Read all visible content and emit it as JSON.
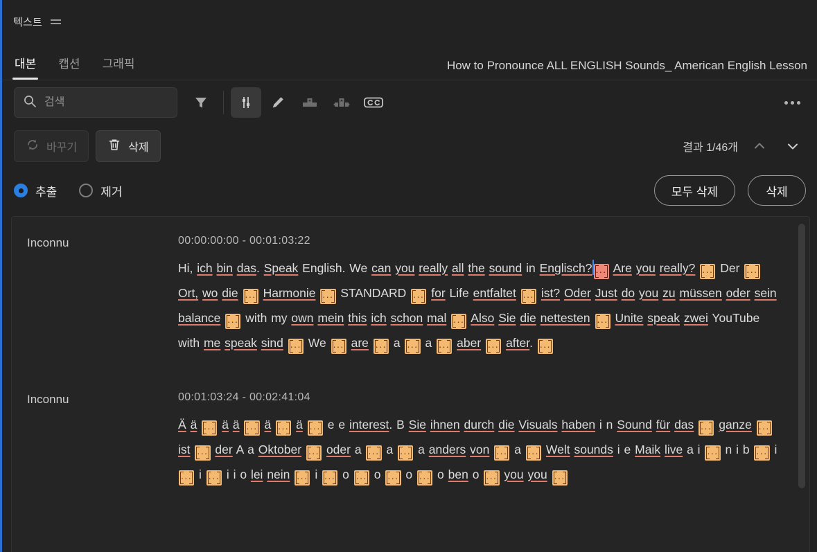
{
  "panel": {
    "title": "텍스트",
    "menu_icon": "hamburger-icon"
  },
  "tabs": [
    {
      "label": "대본",
      "active": true
    },
    {
      "label": "캡션",
      "active": false
    },
    {
      "label": "그래픽",
      "active": false
    }
  ],
  "sequence_title": "How to Pronounce ALL ENGLISH Sounds_ American English Lesson",
  "search": {
    "placeholder": "검색",
    "value": "",
    "icon": "search-icon"
  },
  "toolbar_icons": [
    {
      "name": "filter-icon",
      "selected": false
    },
    {
      "name": "pause-markers-icon",
      "selected": true
    },
    {
      "name": "edit-pencil-icon",
      "selected": false
    },
    {
      "name": "merge-clips-icon",
      "selected": false
    },
    {
      "name": "split-clips-icon",
      "selected": false
    },
    {
      "name": "closed-caption-icon",
      "selected": false
    }
  ],
  "more_menu": {
    "name": "more-options-icon",
    "label": "..."
  },
  "actions": {
    "replace_label": "바꾸기",
    "replace_icon": "refresh-icon",
    "replace_disabled": true,
    "delete_label": "삭제",
    "delete_icon": "trash-icon"
  },
  "results": {
    "text": "결과 1/46개",
    "prev_icon": "chevron-up-icon",
    "next_icon": "chevron-down-icon"
  },
  "mode": {
    "options": [
      {
        "label": "추출",
        "checked": true
      },
      {
        "label": "제거",
        "checked": false
      }
    ],
    "delete_all_label": "모두 삭제",
    "delete_label": "삭제"
  },
  "colors": {
    "accent_blue": "#2a7fe0",
    "token_orange": "#f4ba72",
    "token_highlight": "#f08878",
    "spellcheck_underline": "#e07a6a",
    "panel_bg": "#222222",
    "transcript_bg": "#252525"
  },
  "transcript": {
    "token_text": "...",
    "blocks": [
      {
        "speaker": "Inconnu",
        "timecode": "00:00:00:00 - 00:01:03:22",
        "segments": [
          {
            "t": "text",
            "v": "Hi, "
          },
          {
            "t": "uword",
            "v": "ich"
          },
          {
            "t": "text",
            "v": " "
          },
          {
            "t": "uword",
            "v": "bin"
          },
          {
            "t": "text",
            "v": " "
          },
          {
            "t": "uword",
            "v": "das"
          },
          {
            "t": "text",
            "v": ". "
          },
          {
            "t": "uword",
            "v": "Speak"
          },
          {
            "t": "text",
            "v": " English. We "
          },
          {
            "t": "uword",
            "v": "can"
          },
          {
            "t": "text",
            "v": " "
          },
          {
            "t": "uword",
            "v": "you"
          },
          {
            "t": "text",
            "v": " "
          },
          {
            "t": "uword",
            "v": "really"
          },
          {
            "t": "text",
            "v": " "
          },
          {
            "t": "uword",
            "v": "all"
          },
          {
            "t": "text",
            "v": " "
          },
          {
            "t": "uword",
            "v": "the"
          },
          {
            "t": "text",
            "v": " "
          },
          {
            "t": "uword",
            "v": "sound"
          },
          {
            "t": "text",
            "v": " in "
          },
          {
            "t": "uword",
            "v": "Englisch?"
          },
          {
            "t": "caret"
          },
          {
            "t": "token",
            "hit": true
          },
          {
            "t": "text",
            "v": " "
          },
          {
            "t": "uword",
            "v": "Are"
          },
          {
            "t": "text",
            "v": " "
          },
          {
            "t": "uword",
            "v": "you"
          },
          {
            "t": "text",
            "v": " "
          },
          {
            "t": "uword",
            "v": "really?"
          },
          {
            "t": "text",
            "v": " "
          },
          {
            "t": "token"
          },
          {
            "t": "text",
            "v": " Der "
          },
          {
            "t": "token"
          },
          {
            "t": "text",
            "v": " "
          },
          {
            "t": "uword",
            "v": "Ort,"
          },
          {
            "t": "text",
            "v": " "
          },
          {
            "t": "uword",
            "v": "wo"
          },
          {
            "t": "text",
            "v": " "
          },
          {
            "t": "uword",
            "v": "die"
          },
          {
            "t": "text",
            "v": " "
          },
          {
            "t": "token"
          },
          {
            "t": "text",
            "v": " "
          },
          {
            "t": "uword",
            "v": "Harmonie"
          },
          {
            "t": "text",
            "v": " "
          },
          {
            "t": "token"
          },
          {
            "t": "text",
            "v": " STANDARD "
          },
          {
            "t": "token"
          },
          {
            "t": "text",
            "v": " "
          },
          {
            "t": "uword",
            "v": "for"
          },
          {
            "t": "text",
            "v": " Life "
          },
          {
            "t": "uword",
            "v": "entfaltet"
          },
          {
            "t": "text",
            "v": " "
          },
          {
            "t": "token"
          },
          {
            "t": "text",
            "v": " "
          },
          {
            "t": "uword",
            "v": "ist?"
          },
          {
            "t": "text",
            "v": " "
          },
          {
            "t": "uword",
            "v": "Oder"
          },
          {
            "t": "text",
            "v": " "
          },
          {
            "t": "uword",
            "v": "Just"
          },
          {
            "t": "text",
            "v": " "
          },
          {
            "t": "uword",
            "v": "do"
          },
          {
            "t": "text",
            "v": " "
          },
          {
            "t": "uword",
            "v": "you"
          },
          {
            "t": "text",
            "v": " "
          },
          {
            "t": "uword",
            "v": "zu"
          },
          {
            "t": "text",
            "v": " "
          },
          {
            "t": "uword",
            "v": "müssen"
          },
          {
            "t": "text",
            "v": " "
          },
          {
            "t": "uword",
            "v": "oder"
          },
          {
            "t": "text",
            "v": " "
          },
          {
            "t": "uword",
            "v": "sein"
          },
          {
            "t": "text",
            "v": " "
          },
          {
            "t": "uword",
            "v": "balance"
          },
          {
            "t": "text",
            "v": " "
          },
          {
            "t": "token"
          },
          {
            "t": "text",
            "v": " with my "
          },
          {
            "t": "uword",
            "v": "own"
          },
          {
            "t": "text",
            "v": " "
          },
          {
            "t": "uword",
            "v": "mein"
          },
          {
            "t": "text",
            "v": " "
          },
          {
            "t": "uword",
            "v": "this"
          },
          {
            "t": "text",
            "v": " "
          },
          {
            "t": "uword",
            "v": "ich"
          },
          {
            "t": "text",
            "v": " "
          },
          {
            "t": "uword",
            "v": "schon"
          },
          {
            "t": "text",
            "v": " "
          },
          {
            "t": "uword",
            "v": "mal"
          },
          {
            "t": "text",
            "v": " "
          },
          {
            "t": "token"
          },
          {
            "t": "text",
            "v": " "
          },
          {
            "t": "uword",
            "v": "Also"
          },
          {
            "t": "text",
            "v": " "
          },
          {
            "t": "uword",
            "v": "Sie"
          },
          {
            "t": "text",
            "v": " "
          },
          {
            "t": "uword",
            "v": "die"
          },
          {
            "t": "text",
            "v": " "
          },
          {
            "t": "uword",
            "v": "nettesten"
          },
          {
            "t": "text",
            "v": " "
          },
          {
            "t": "token"
          },
          {
            "t": "text",
            "v": " "
          },
          {
            "t": "uword",
            "v": "Unite"
          },
          {
            "t": "text",
            "v": " "
          },
          {
            "t": "uword",
            "v": "speak"
          },
          {
            "t": "text",
            "v": " "
          },
          {
            "t": "uword",
            "v": "zwei"
          },
          {
            "t": "text",
            "v": " YouTube with "
          },
          {
            "t": "uword",
            "v": "me"
          },
          {
            "t": "text",
            "v": " "
          },
          {
            "t": "uword",
            "v": "speak"
          },
          {
            "t": "text",
            "v": " "
          },
          {
            "t": "uword",
            "v": "sind"
          },
          {
            "t": "text",
            "v": " "
          },
          {
            "t": "token"
          },
          {
            "t": "text",
            "v": " We "
          },
          {
            "t": "token"
          },
          {
            "t": "text",
            "v": " "
          },
          {
            "t": "uword",
            "v": "are"
          },
          {
            "t": "text",
            "v": " "
          },
          {
            "t": "token"
          },
          {
            "t": "text",
            "v": " a "
          },
          {
            "t": "token"
          },
          {
            "t": "text",
            "v": " a "
          },
          {
            "t": "token"
          },
          {
            "t": "text",
            "v": " "
          },
          {
            "t": "uword",
            "v": "aber"
          },
          {
            "t": "text",
            "v": " "
          },
          {
            "t": "token"
          },
          {
            "t": "text",
            "v": " "
          },
          {
            "t": "uword",
            "v": "after"
          },
          {
            "t": "text",
            "v": ". "
          },
          {
            "t": "token"
          }
        ]
      },
      {
        "speaker": "Inconnu",
        "timecode": "00:01:03:24 - 00:02:41:04",
        "segments": [
          {
            "t": "uword",
            "v": "Ä"
          },
          {
            "t": "text",
            "v": " "
          },
          {
            "t": "uword",
            "v": "ä"
          },
          {
            "t": "text",
            "v": " "
          },
          {
            "t": "token"
          },
          {
            "t": "text",
            "v": " "
          },
          {
            "t": "uword",
            "v": "ä"
          },
          {
            "t": "text",
            "v": " "
          },
          {
            "t": "uword",
            "v": "ä"
          },
          {
            "t": "text",
            "v": " "
          },
          {
            "t": "token"
          },
          {
            "t": "text",
            "v": " "
          },
          {
            "t": "uword",
            "v": "ä"
          },
          {
            "t": "text",
            "v": " "
          },
          {
            "t": "token"
          },
          {
            "t": "text",
            "v": " "
          },
          {
            "t": "uword",
            "v": "ä"
          },
          {
            "t": "text",
            "v": " "
          },
          {
            "t": "token"
          },
          {
            "t": "text",
            "v": " e e "
          },
          {
            "t": "uword",
            "v": "interest"
          },
          {
            "t": "text",
            "v": ". B "
          },
          {
            "t": "uword",
            "v": "Sie"
          },
          {
            "t": "text",
            "v": " "
          },
          {
            "t": "uword",
            "v": "ihnen"
          },
          {
            "t": "text",
            "v": " "
          },
          {
            "t": "uword",
            "v": "durch"
          },
          {
            "t": "text",
            "v": " "
          },
          {
            "t": "uword",
            "v": "die"
          },
          {
            "t": "text",
            "v": " "
          },
          {
            "t": "uword",
            "v": "Visuals"
          },
          {
            "t": "text",
            "v": " "
          },
          {
            "t": "uword",
            "v": "haben"
          },
          {
            "t": "text",
            "v": " i n "
          },
          {
            "t": "uword",
            "v": "Sound"
          },
          {
            "t": "text",
            "v": " "
          },
          {
            "t": "uword",
            "v": "für"
          },
          {
            "t": "text",
            "v": " "
          },
          {
            "t": "uword",
            "v": "das"
          },
          {
            "t": "text",
            "v": " "
          },
          {
            "t": "token"
          },
          {
            "t": "text",
            "v": " "
          },
          {
            "t": "uword",
            "v": "ganze"
          },
          {
            "t": "text",
            "v": " "
          },
          {
            "t": "token"
          },
          {
            "t": "text",
            "v": " "
          },
          {
            "t": "uword",
            "v": "ist"
          },
          {
            "t": "text",
            "v": " "
          },
          {
            "t": "token"
          },
          {
            "t": "text",
            "v": " "
          },
          {
            "t": "uword",
            "v": "der"
          },
          {
            "t": "text",
            "v": " A a "
          },
          {
            "t": "uword",
            "v": "Oktober"
          },
          {
            "t": "text",
            "v": " "
          },
          {
            "t": "token"
          },
          {
            "t": "text",
            "v": " "
          },
          {
            "t": "uword",
            "v": "oder"
          },
          {
            "t": "text",
            "v": " a "
          },
          {
            "t": "token"
          },
          {
            "t": "text",
            "v": " a "
          },
          {
            "t": "token"
          },
          {
            "t": "text",
            "v": " a "
          },
          {
            "t": "uword",
            "v": "anders"
          },
          {
            "t": "text",
            "v": " "
          },
          {
            "t": "uword",
            "v": "von"
          },
          {
            "t": "text",
            "v": " "
          },
          {
            "t": "token"
          },
          {
            "t": "text",
            "v": " a "
          },
          {
            "t": "token"
          },
          {
            "t": "text",
            "v": " "
          },
          {
            "t": "uword",
            "v": "Welt"
          },
          {
            "t": "text",
            "v": " "
          },
          {
            "t": "uword",
            "v": "sounds"
          },
          {
            "t": "text",
            "v": " i e "
          },
          {
            "t": "uword",
            "v": "Maik"
          },
          {
            "t": "text",
            "v": " "
          },
          {
            "t": "uword",
            "v": "live"
          },
          {
            "t": "text",
            "v": " a i "
          },
          {
            "t": "token"
          },
          {
            "t": "text",
            "v": " n i b "
          },
          {
            "t": "token"
          },
          {
            "t": "text",
            "v": " i "
          },
          {
            "t": "token"
          },
          {
            "t": "text",
            "v": " i "
          },
          {
            "t": "token"
          },
          {
            "t": "text",
            "v": " i i o "
          },
          {
            "t": "uword",
            "v": "lei"
          },
          {
            "t": "text",
            "v": " "
          },
          {
            "t": "uword",
            "v": "nein"
          },
          {
            "t": "text",
            "v": " "
          },
          {
            "t": "token"
          },
          {
            "t": "text",
            "v": " i "
          },
          {
            "t": "token"
          },
          {
            "t": "text",
            "v": " o "
          },
          {
            "t": "token"
          },
          {
            "t": "text",
            "v": " o "
          },
          {
            "t": "token"
          },
          {
            "t": "text",
            "v": " o "
          },
          {
            "t": "token"
          },
          {
            "t": "text",
            "v": " o "
          },
          {
            "t": "uword",
            "v": "ben"
          },
          {
            "t": "text",
            "v": " o "
          },
          {
            "t": "token"
          },
          {
            "t": "text",
            "v": " "
          },
          {
            "t": "uword",
            "v": "you"
          },
          {
            "t": "text",
            "v": " "
          },
          {
            "t": "uword",
            "v": "you"
          },
          {
            "t": "text",
            "v": " "
          },
          {
            "t": "token"
          }
        ]
      }
    ]
  },
  "scrollbar": {
    "name": "transcript-scrollbar"
  }
}
